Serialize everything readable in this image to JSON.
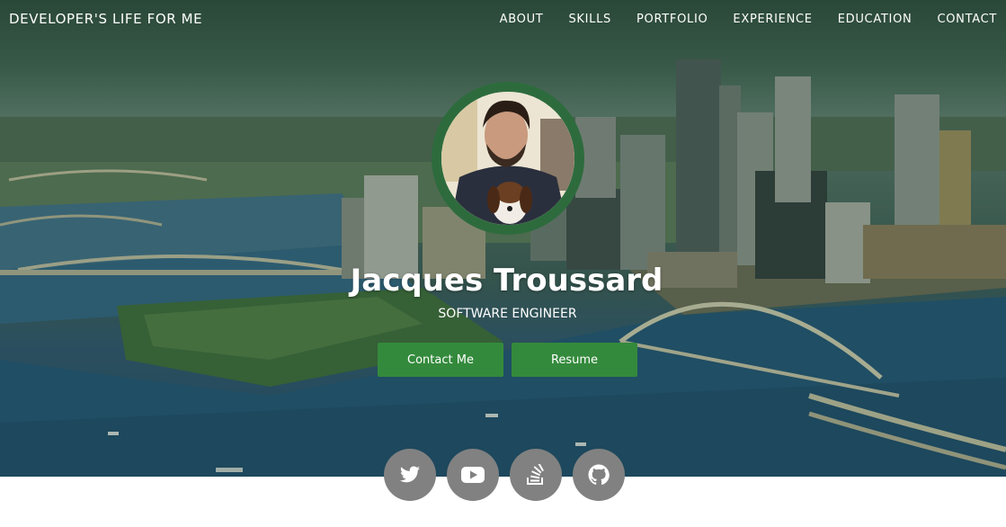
{
  "navbar": {
    "brand": "DEVELOPER'S LIFE FOR ME",
    "links": [
      "ABOUT",
      "SKILLS",
      "PORTFOLIO",
      "EXPERIENCE",
      "EDUCATION",
      "CONTACT"
    ]
  },
  "hero": {
    "name": "Jacques Troussard",
    "title": "SOFTWARE ENGINEER",
    "contact_button": "Contact Me",
    "resume_button": "Resume"
  },
  "social": {
    "icons": [
      "twitter-icon",
      "youtube-icon",
      "stack-overflow-icon",
      "github-icon"
    ]
  },
  "colors": {
    "accent_green": "#348a3c",
    "avatar_ring": "#2d6b3d",
    "social_bg": "#818181"
  }
}
